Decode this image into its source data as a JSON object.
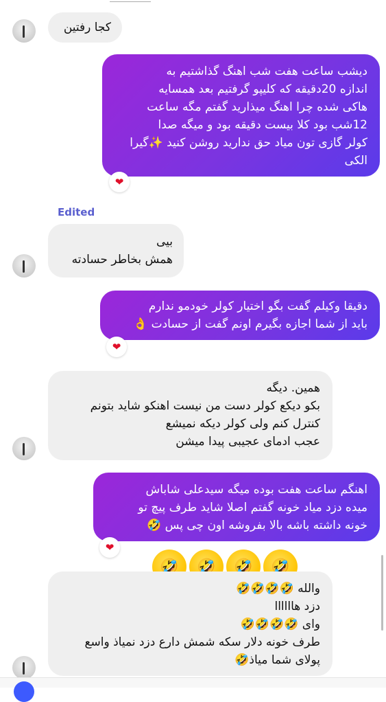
{
  "edited_label": "Edited",
  "reaction_heart": "❤",
  "reaction_laugh": "🤣",
  "messages": {
    "m1": {
      "lines": [
        "کجا رفتین"
      ]
    },
    "m2": {
      "lines": [
        "دیشب ساعت هفت شب اهنگ گذاشتیم به",
        "اندازه 20دقیقه که کلیپو گرفتیم بعد همسایه",
        "هاکی شده چرا اهنگ میذارید گفتم مگه ساعت",
        "12شب بود کلا بیست دقیقه بود و میگه صدا",
        "کولر گازی تون میاد حق ندارید روشن کنید  ✨گیرا",
        "الکی"
      ]
    },
    "m3": {
      "lines": [
        "بیی",
        "همش بخاطر حسادته"
      ]
    },
    "m4": {
      "lines": [
        "دقیقا وکیلم گفت بگو اختیار کولر خودمو ندارم",
        "باید از شما اجازه بگیرم اونم گفت از حسادت 👌"
      ]
    },
    "m5": {
      "lines": [
        "همین. دیگه",
        "بکو دیکع کولر دست من نیست اهنکو شاید بتونم",
        "کنترل کنم ولی کولر دیکه نمیشع",
        "عجب ادمای عجیبی پیدا میشن"
      ]
    },
    "m6": {
      "lines": [
        "اهنگم ساعت هفت بوده میگه سیدعلی شاباش",
        "میده دزد میاد خونه گفتم اصلا شاید طرف پیچ تو",
        "خونه داشته باشه بالا بفروشه اون چی پس 🤣"
      ]
    },
    "m7": {
      "lines": [
        "والله 🤣🤣🤣🤣",
        "دزد هاااااا",
        "وای 🤣🤣🤣🤣",
        "طرف خونه دلار سکه شمش دارع دزد نمیاذ واسع",
        "پولای شما میاذ🤣"
      ]
    }
  }
}
